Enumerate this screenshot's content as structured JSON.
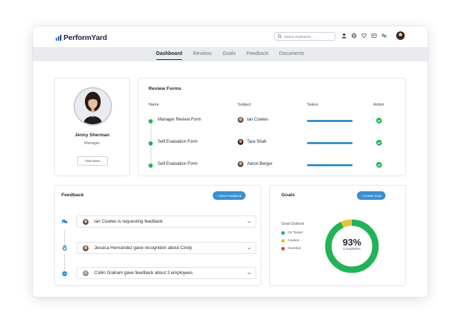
{
  "app": {
    "name": "PerformYard"
  },
  "search": {
    "placeholder": "Search employees..."
  },
  "top_icons": [
    "user-icon",
    "globe-icon",
    "heart-icon",
    "message-icon",
    "link-icon"
  ],
  "nav": {
    "tabs": [
      {
        "label": "Dashboard",
        "active": true
      },
      {
        "label": "Reviews",
        "active": false
      },
      {
        "label": "Goals",
        "active": false
      },
      {
        "label": "Feedback",
        "active": false
      },
      {
        "label": "Documents",
        "active": false
      }
    ]
  },
  "profile": {
    "name": "Jenny Sherman",
    "role": "Manager",
    "view_more_label": "View More"
  },
  "review_forms": {
    "title": "Review Forms",
    "columns": {
      "name": "Name",
      "subject": "Subject",
      "status": "Status",
      "action": "Action"
    },
    "rows": [
      {
        "name": "Manager Review Form",
        "subject": "Ian Cowles",
        "status_progress": 1.0,
        "completed": true
      },
      {
        "name": "Self Evaluation Form",
        "subject": "Tara Shah",
        "status_progress": 1.0,
        "completed": true
      },
      {
        "name": "Self Evaluation Form",
        "subject": "Aaron Berger",
        "status_progress": 1.0,
        "completed": true
      }
    ]
  },
  "feedback": {
    "title": "Feedback",
    "button_label": "+ Give Feedback",
    "items": [
      {
        "icon": "chat-request-icon",
        "text": "Ian Cowles is requesting feedback"
      },
      {
        "icon": "award-icon",
        "text": "Jessica Hernandez gave recognition about Cindy"
      },
      {
        "icon": "chat-icon",
        "text": "Collin Graham gave feedback about 2 employees"
      }
    ]
  },
  "goals": {
    "title": "Goals",
    "button_label": "+ Create Goal",
    "outlook_title": "Goal Outlook",
    "legend": [
      {
        "label": "On Target",
        "color": "#21b35a"
      },
      {
        "label": "Caution",
        "color": "#e8c43a"
      },
      {
        "label": "Overdue",
        "color": "#e0493a"
      }
    ],
    "completion_pct": 93,
    "completion_text": "93%",
    "completion_label": "Completion"
  },
  "colors": {
    "accent": "#3a8fd0",
    "success": "#21b35a",
    "caution": "#e8c43a",
    "danger": "#e0493a"
  }
}
